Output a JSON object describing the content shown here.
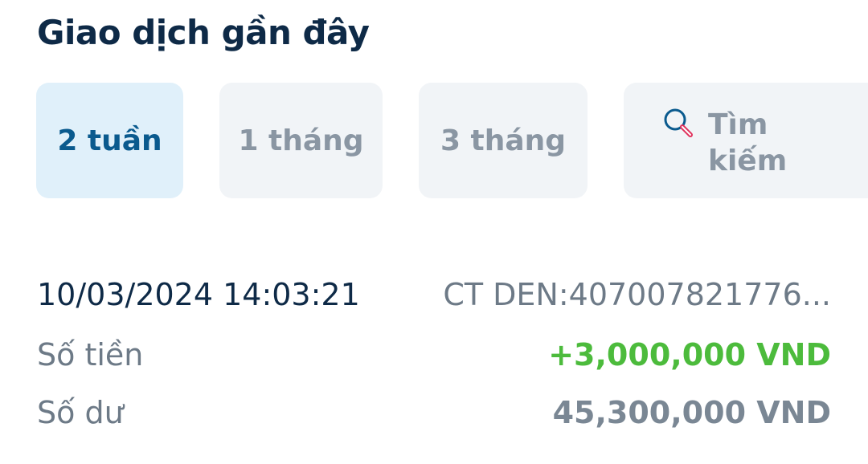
{
  "header": {
    "title": "Giao dịch gần đây"
  },
  "filters": {
    "items": [
      {
        "label": "2 tuần",
        "active": true
      },
      {
        "label": "1 tháng",
        "active": false
      },
      {
        "label": "3 tháng",
        "active": false
      }
    ],
    "search_label": "Tìm kiếm",
    "search_icon": "search-icon"
  },
  "transaction": {
    "datetime": "10/03/2024 14:03:21",
    "reference": "CT DEN:407007821776...",
    "amount_label": "Số tiền",
    "amount_value": "+3,000,000 VND",
    "balance_label": "Số dư",
    "balance_value": "45,300,000 VND"
  },
  "colors": {
    "title": "#0e2a47",
    "active_chip_bg": "#e0f0fa",
    "active_chip_text": "#0a5a8e",
    "chip_bg": "#f1f4f7",
    "chip_text": "#8a96a3",
    "amount_positive": "#4cbb3c",
    "search_icon_ring": "#0a5a8e",
    "search_icon_handle": "#e0315c"
  }
}
